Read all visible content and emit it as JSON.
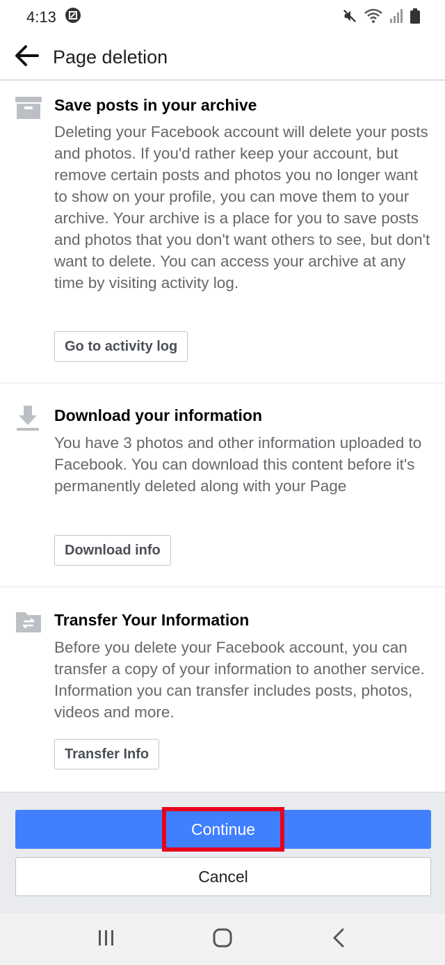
{
  "status_bar": {
    "time": "4:13",
    "icons": [
      "notification-icon",
      "mute-icon",
      "wifi-icon",
      "signal-icon",
      "battery-icon"
    ]
  },
  "app_bar": {
    "title": "Page deletion",
    "back_icon": "arrow-left-icon"
  },
  "sections": [
    {
      "icon": "archive-box-icon",
      "title": "Save posts in your archive",
      "body": "Deleting your Facebook account will delete your posts and photos. If you'd rather keep your account, but remove certain posts and photos you no longer want to show on your profile, you can move them to your archive. Your archive is a place for you to save posts and photos that you don't want others to see, but don't want to delete. You can access your archive at any time by visiting activity log.",
      "button": "Go to activity log"
    },
    {
      "icon": "download-icon",
      "title": "Download your information",
      "body": "You have 3 photos and other information uploaded to Facebook. You can download this content before it's permanently deleted along with your Page",
      "button": "Download info"
    },
    {
      "icon": "folder-transfer-icon",
      "title": "Transfer Your Information",
      "body": "Before you delete your Facebook account, you can transfer a copy of your information to another service. Information you can transfer includes posts, photos, videos and more.",
      "button": "Transfer Info"
    }
  ],
  "footer": {
    "continue_label": "Continue",
    "cancel_label": "Cancel"
  },
  "nav_bar": {
    "icons": [
      "recent-apps-icon",
      "home-icon",
      "back-icon"
    ]
  },
  "colors": {
    "primary": "#4080ff",
    "highlight": "#e8001c",
    "text_secondary": "#65676b"
  }
}
